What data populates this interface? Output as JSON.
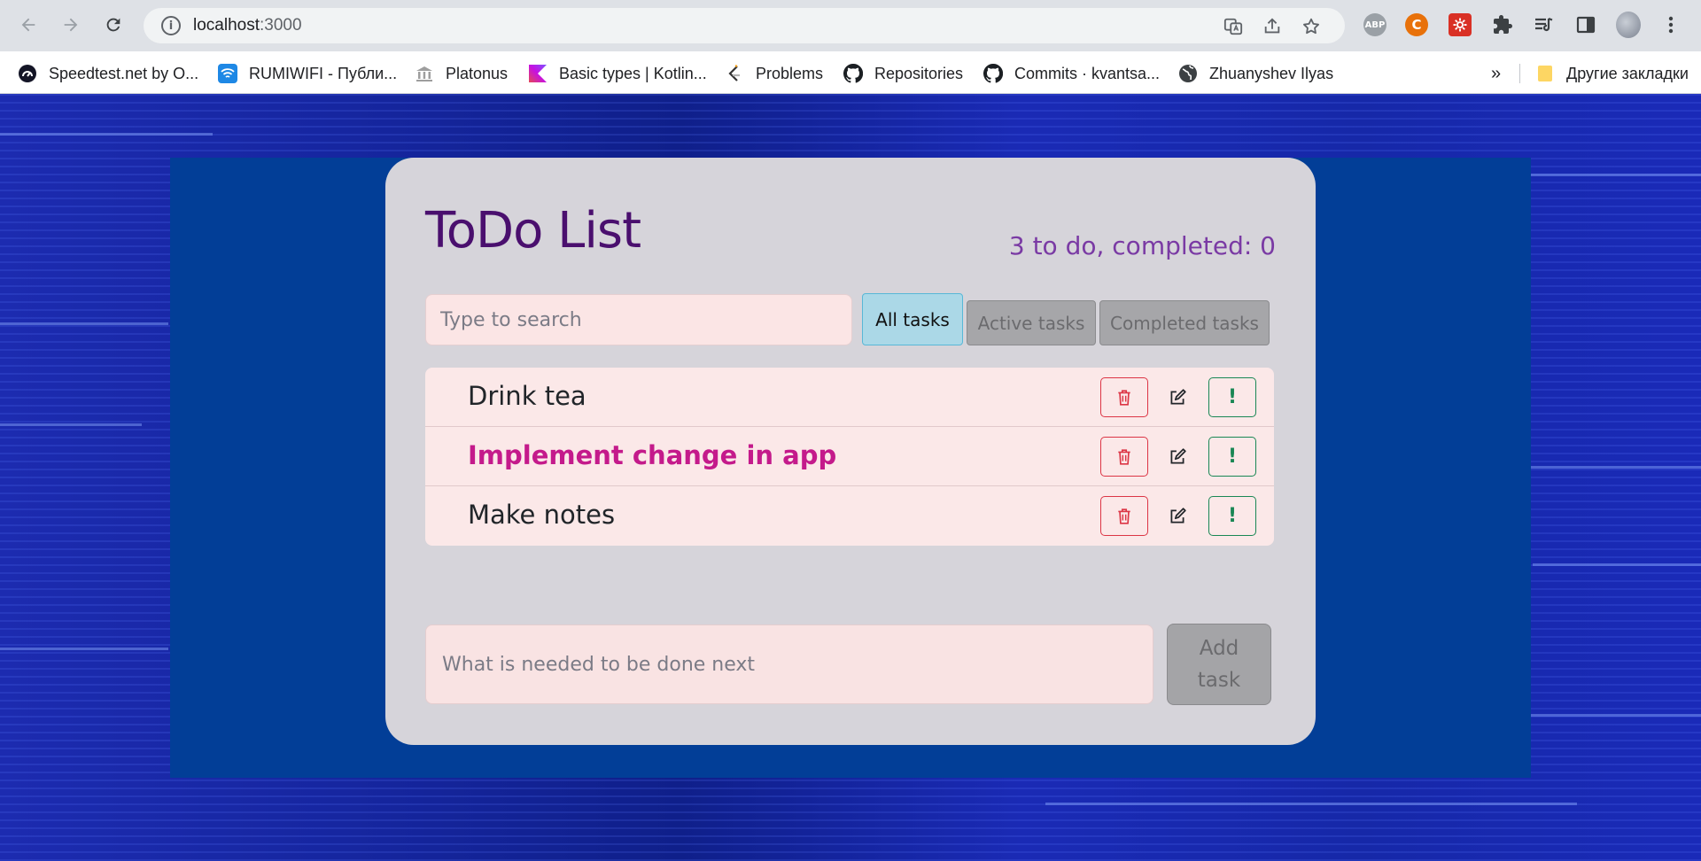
{
  "browser": {
    "url_host": "localhost",
    "url_port": ":3000",
    "bookmarks": [
      {
        "label": "Speedtest.net by O...",
        "icon": "speedtest-icon"
      },
      {
        "label": "RUMIWIFI - Публи...",
        "icon": "wifi-icon"
      },
      {
        "label": "Platonus",
        "icon": "building-icon"
      },
      {
        "label": "Basic types | Kotlin...",
        "icon": "kotlin-icon"
      },
      {
        "label": "Problems",
        "icon": "leetcode-icon"
      },
      {
        "label": "Repositories",
        "icon": "github-icon"
      },
      {
        "label": "Commits · kvantsa...",
        "icon": "github-icon"
      },
      {
        "label": "Zhuanyshev Ilyas",
        "icon": "globe-icon"
      }
    ],
    "more_label": "»",
    "other_bookmarks": "Другие закладки",
    "extensions": {
      "abp": "ABP",
      "c": "C"
    }
  },
  "app": {
    "title": "ToDo List",
    "counter": "3 to do, completed: 0",
    "search_placeholder": "Type to search",
    "filters": {
      "all": "All tasks",
      "active": "Active tasks",
      "completed": "Completed tasks"
    },
    "tasks": [
      {
        "label": "Drink tea",
        "important": false
      },
      {
        "label": "Implement change in app",
        "important": true
      },
      {
        "label": "Make notes",
        "important": false
      }
    ],
    "important_symbol": "!",
    "add_placeholder": "What is needed to be done next",
    "add_button": "Add task",
    "colors": {
      "title": "#4a0f6e",
      "counter": "#7a3aa4",
      "important_task": "#c41a8b",
      "danger": "#dc3545",
      "success": "#198754",
      "active_filter": "#abd8e7"
    }
  }
}
